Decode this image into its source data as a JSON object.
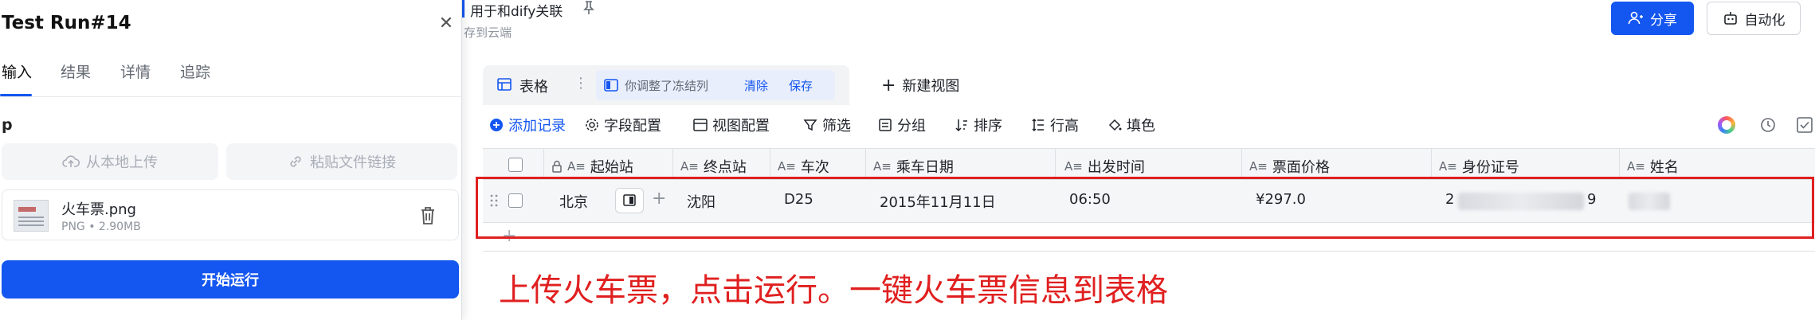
{
  "panel": {
    "title": "Test Run#14",
    "tabs": [
      {
        "label": "输入",
        "active": true
      },
      {
        "label": "结果",
        "active": false
      },
      {
        "label": "详情",
        "active": false
      },
      {
        "label": "追踪",
        "active": false
      }
    ],
    "field_label": "p",
    "upload_local": "从本地上传",
    "paste_link": "粘贴文件链接",
    "file": {
      "name": "火车票.png",
      "meta": "PNG • 2.90MB"
    },
    "run_button": "开始运行"
  },
  "header": {
    "title": "用于和dify关联",
    "subtitle": "存到云端",
    "share": "分享",
    "automation": "自动化"
  },
  "view_bar": {
    "tab_label": "表格",
    "freeze_notice": "你调整了冻结列",
    "clear": "清除",
    "save": "保存",
    "new_view": "新建视图"
  },
  "toolbar": {
    "add_record": "添加记录",
    "field_config": "字段配置",
    "view_config": "视图配置",
    "filter": "筛选",
    "group": "分组",
    "sort": "排序",
    "row_height": "行高",
    "fill": "填色"
  },
  "table": {
    "field_type_glyph": "A≡",
    "columns": [
      "起始站",
      "终点站",
      "车次",
      "乘车日期",
      "出发时间",
      "票面价格",
      "身份证号",
      "姓名"
    ],
    "row": {
      "start": "北京",
      "end": "沈阳",
      "train": "D25",
      "date": "2015年11月11日",
      "time": "06:50",
      "price": "¥297.0",
      "id_visible_start": "2",
      "id_visible_end": "9"
    }
  },
  "annotation": "上传火车票，点击运行。一键火车票信息到表格",
  "colors": {
    "accent": "#1456f0",
    "annotation": "#e02020"
  }
}
